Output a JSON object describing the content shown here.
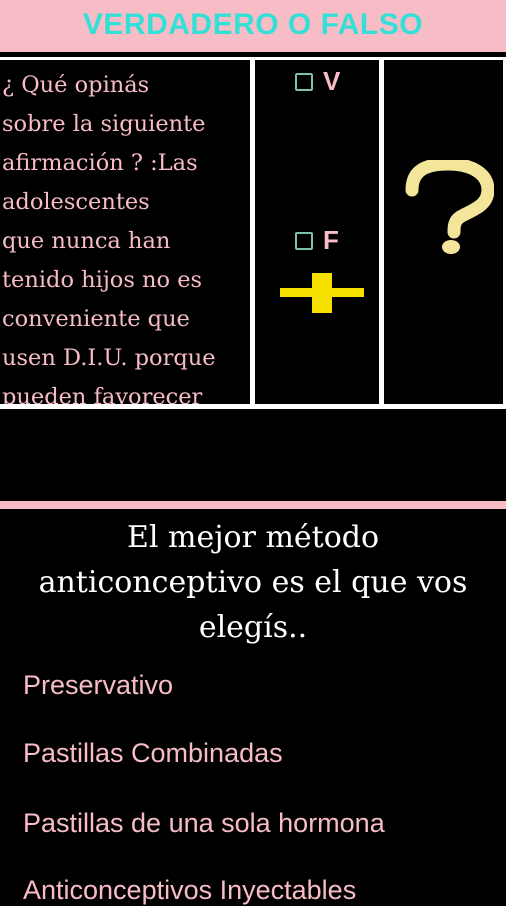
{
  "header": {
    "title": "VERDADERO O FALSO"
  },
  "quiz": {
    "question_lines": [
      "¿ Qué opinás",
      "sobre la siguiente",
      "afirmación ? :Las",
      "adolescentes",
      "que nunca han",
      "tenido hijos no es",
      "conveniente que",
      "usen D.I.U. porque",
      "pueden favorecer"
    ],
    "option_true": "V",
    "option_false": "F"
  },
  "tip": {
    "lines": [
      "El mejor método",
      "anticonceptivo es el que vos",
      "elegís.."
    ]
  },
  "methods": [
    "Preservativo",
    "Pastillas Combinadas",
    "Pastillas de una sola hormona",
    "Anticonceptivos Inyectables"
  ],
  "icons": {
    "checkbox": "checkbox-icon",
    "cross": "yellow-cross-icon",
    "question": "question-mark-icon"
  },
  "colors": {
    "pink": "#f8bcc6",
    "teal": "#33e0d8",
    "yellow": "#f5e000",
    "cream": "#f3e69a",
    "checkbox": "#7bc1a4"
  }
}
